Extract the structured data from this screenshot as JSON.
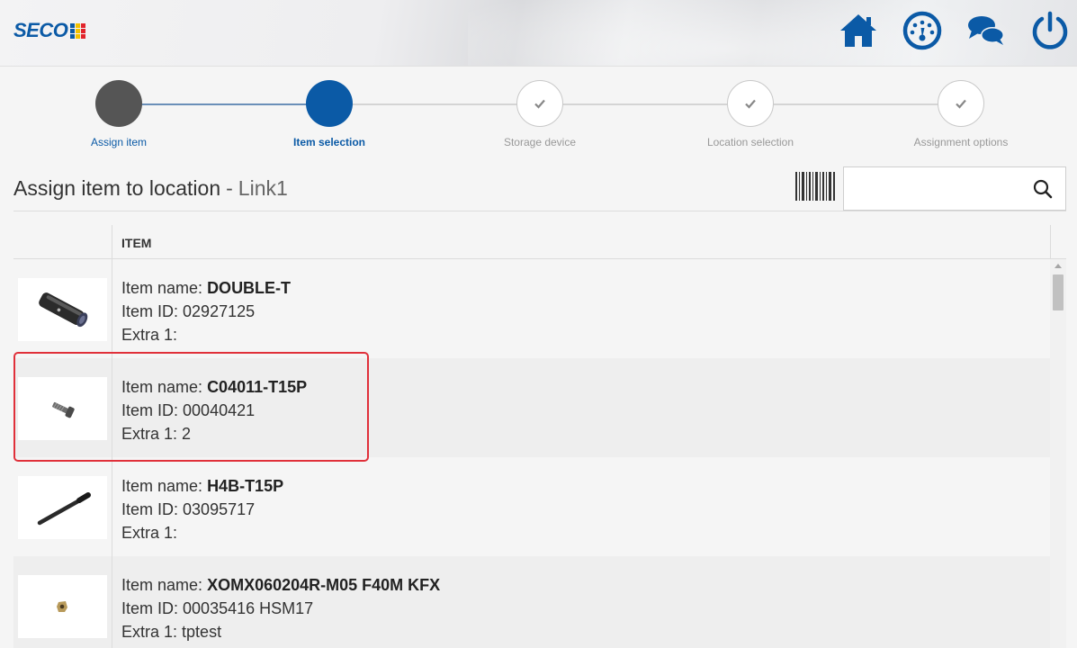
{
  "app": {
    "logo_text": "SECO",
    "brand_color": "#0b5aa6",
    "logo_mark_colors": [
      "#0b5aa6",
      "#f2c200",
      "#e2242b",
      "#0b5aa6",
      "#f2c200",
      "#e2242b",
      "#0b5aa6",
      "#f2c200",
      "#e2242b"
    ]
  },
  "header": {
    "icons": [
      "home-icon",
      "dashboard-gauge-icon",
      "chat-icon",
      "power-icon"
    ]
  },
  "stepper": {
    "steps": [
      {
        "label": "Assign item",
        "state": "done",
        "color": "#555555"
      },
      {
        "label": "Item selection",
        "state": "active",
        "color": "#0b5aa6"
      },
      {
        "label": "Storage device",
        "state": "pending",
        "icon": "check-icon"
      },
      {
        "label": "Location selection",
        "state": "pending",
        "icon": "check-icon"
      },
      {
        "label": "Assignment options",
        "state": "pending",
        "icon": "check-icon"
      }
    ]
  },
  "page": {
    "title": "Assign item to location",
    "separator": "-",
    "subtitle": "Link1"
  },
  "search": {
    "value": "",
    "placeholder": ""
  },
  "table": {
    "column_header": "ITEM",
    "label_item_name": "Item name:",
    "label_item_id": "Item ID:",
    "label_extra": "Extra 1:",
    "rows": [
      {
        "item_name": "DOUBLE-T",
        "item_id": "02927125",
        "extra1": "",
        "thumbnail": "double-t-wrench-image"
      },
      {
        "item_name": "C04011-T15P",
        "item_id": "00040421",
        "extra1": "2",
        "thumbnail": "screw-image",
        "highlighted": true
      },
      {
        "item_name": "H4B-T15P",
        "item_id": "03095717",
        "extra1": "",
        "thumbnail": "screwdriver-bit-image"
      },
      {
        "item_name": "XOMX060204R-M05 F40M KFX",
        "item_id": "00035416 HSM17",
        "extra1": "tptest",
        "thumbnail": "insert-image"
      }
    ]
  },
  "colors": {
    "highlight_outline": "#e0303a",
    "active_step": "#0b5aa6",
    "done_step": "#555555"
  }
}
